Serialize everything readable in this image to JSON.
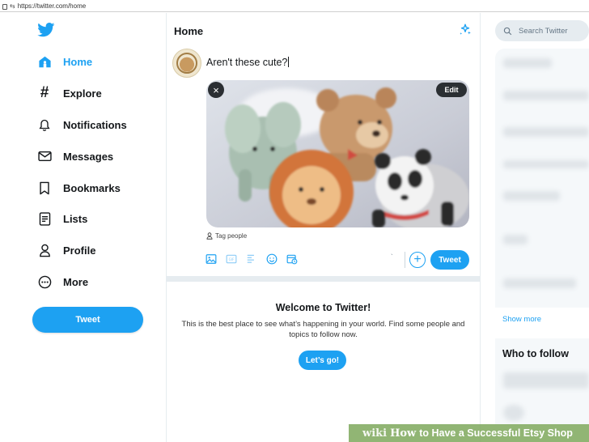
{
  "browser": {
    "url": "https://twitter.com/home"
  },
  "nav": {
    "items": [
      {
        "label": "Home",
        "icon": "home-icon",
        "active": true
      },
      {
        "label": "Explore",
        "icon": "hashtag-icon"
      },
      {
        "label": "Notifications",
        "icon": "bell-icon"
      },
      {
        "label": "Messages",
        "icon": "envelope-icon"
      },
      {
        "label": "Bookmarks",
        "icon": "bookmark-icon"
      },
      {
        "label": "Lists",
        "icon": "list-icon"
      },
      {
        "label": "Profile",
        "icon": "person-icon"
      },
      {
        "label": "More",
        "icon": "more-icon"
      }
    ],
    "tweet_button": "Tweet"
  },
  "main": {
    "title": "Home",
    "compose": {
      "text": "Aren't these cute?",
      "edit_label": "Edit",
      "tag_people": "Tag people",
      "counter": "`",
      "tweet_button": "Tweet"
    },
    "welcome": {
      "title": "Welcome to Twitter!",
      "body": "This is the best place to see what’s happening in your world. Find some people and topics to follow now.",
      "button": "Let’s go!"
    }
  },
  "sidebar": {
    "search_placeholder": "Search Twitter",
    "show_more": "Show more",
    "who_to_follow": "Who to follow"
  },
  "watermark": {
    "wiki": "wiki",
    "how": "How",
    "title": "to Have a Successful Etsy Shop"
  },
  "colors": {
    "accent": "#1da1f2",
    "text": "#14171a",
    "muted": "#657786",
    "wiki_green": "#7ea85c"
  }
}
